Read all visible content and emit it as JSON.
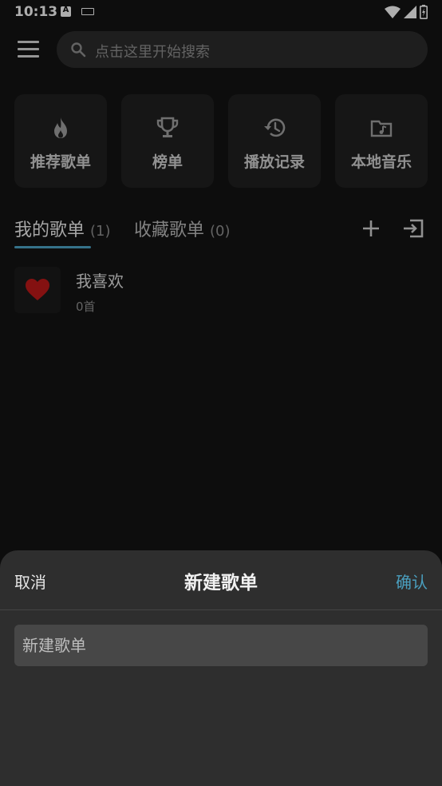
{
  "status_bar": {
    "time": "10:13",
    "notification_a": "A"
  },
  "search": {
    "placeholder": "点击这里开始搜索"
  },
  "quick_cards": [
    {
      "label": "推荐歌单",
      "icon": "fire-icon"
    },
    {
      "label": "榜单",
      "icon": "trophy-icon"
    },
    {
      "label": "播放记录",
      "icon": "history-icon"
    },
    {
      "label": "本地音乐",
      "icon": "music-folder-icon"
    }
  ],
  "tabs": [
    {
      "label": "我的歌单",
      "count": "(1)",
      "active": true
    },
    {
      "label": "收藏歌单",
      "count": "(0)",
      "active": false
    }
  ],
  "playlists": [
    {
      "name": "我喜欢",
      "count": "0首"
    }
  ],
  "sheet": {
    "cancel_label": "取消",
    "title": "新建歌单",
    "confirm_label": "确认",
    "input_placeholder": "新建歌单",
    "input_value": ""
  },
  "colors": {
    "accent": "#4a9fbf",
    "heart": "#c81e1e",
    "background": "#121212"
  }
}
